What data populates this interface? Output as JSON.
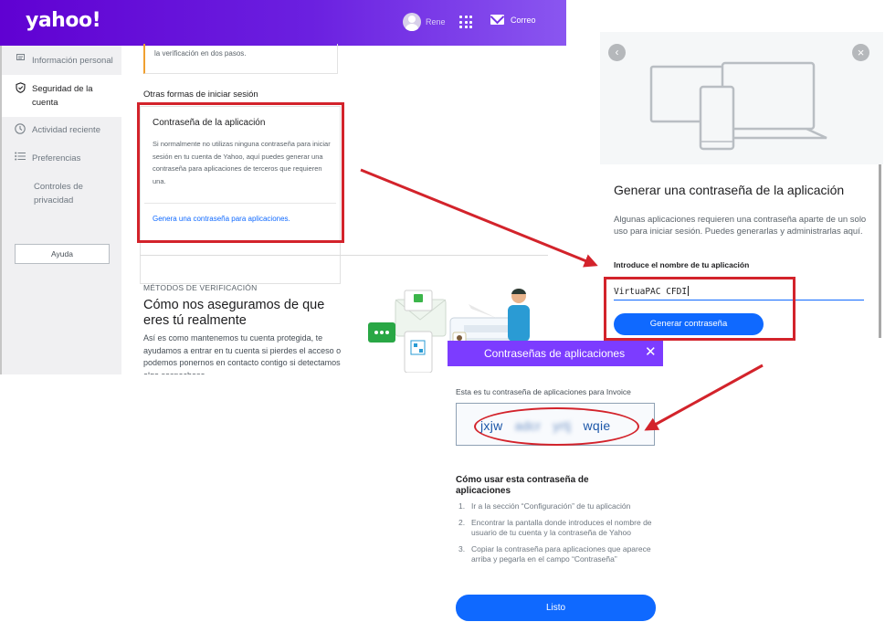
{
  "colors": {
    "brand_purple": "#6001d2",
    "accent_blue": "#0f69ff",
    "highlight_red": "#d3232b",
    "dialog_purple": "#7c3cff"
  },
  "header": {
    "logo": "yahoo!",
    "user_name": "Rene",
    "mail_label": "Correo",
    "icons": [
      "avatar-icon",
      "apps-grid-icon",
      "mail-icon"
    ]
  },
  "sidebar": {
    "items": [
      {
        "label": "Información personal",
        "icon": "id-card-icon"
      },
      {
        "label": "Seguridad de la cuenta",
        "icon": "shield-icon",
        "active": true
      },
      {
        "label": "Actividad reciente",
        "icon": "clock-icon"
      },
      {
        "label": "Preferencias",
        "icon": "list-icon"
      },
      {
        "label": "Controles de privacidad",
        "icon": ""
      }
    ],
    "help_label": "Ayuda"
  },
  "main": {
    "prev_card_text": "la verificación en dos pasos.",
    "other_signin_title": "Otras formas de iniciar sesión",
    "app_password_card": {
      "title": "Contraseña de la aplicación",
      "text": "Si normalmente no utilizas ninguna contraseña para iniciar sesión en tu cuenta de Yahoo, aquí puedes generar una contraseña para aplicaciones de terceros que requieren una.",
      "link": "Genera una contraseña para aplicaciones."
    },
    "verification": {
      "eyebrow": "MÉTODOS DE VERIFICACIÓN",
      "headline": "Cómo nos aseguramos de que eres tú realmente",
      "body": "Así es como mantenemos tu cuenta protegida, te ayudamos a entrar en tu cuenta si pierdes el acceso o podemos ponernos en contacto contigo si detectamos algo sospechoso."
    }
  },
  "generate_dialog": {
    "title": "Generar una contraseña de la aplicación",
    "description": "Algunas aplicaciones requieren una contraseña aparte de un solo uso para iniciar sesión. Puedes generarlas y administrarlas aquí.",
    "input_label": "Introduce el nombre de tu aplicación",
    "input_value": "VirtuaPAC CFDI",
    "button": "Generar contraseña",
    "icons": [
      "back-icon",
      "close-icon",
      "devices-illustration"
    ]
  },
  "app_passwords_dialog": {
    "title": "Contraseñas de aplicaciones",
    "close": "✕",
    "line": "Esta es tu contraseña de aplicaciones para Invoice",
    "password_parts": [
      "jxjw",
      "adcr",
      "yrtj",
      "wqie"
    ],
    "howto_title": "Cómo usar esta contraseña de aplicaciones",
    "steps": [
      {
        "num": "1.",
        "text": "Ir a la sección “Configuración” de tu aplicación"
      },
      {
        "num": "2.",
        "text": "Encontrar la pantalla donde introduces el nombre de usuario de tu cuenta y la contraseña de Yahoo"
      },
      {
        "num": "3.",
        "text": "Copiar la contraseña para aplicaciones que aparece arriba y pegarla en el campo “Contraseña”"
      }
    ],
    "button": "Listo"
  }
}
